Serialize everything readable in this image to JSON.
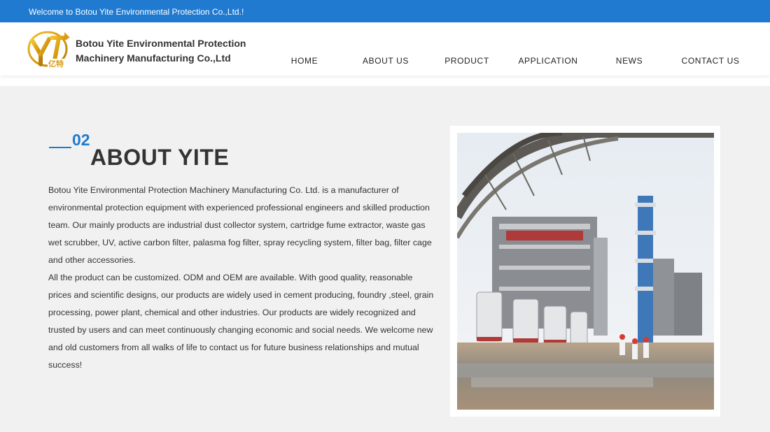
{
  "topbar": {
    "welcome": "Welcome to Botou Yite Environmental Protection Co.,Ltd.!"
  },
  "header": {
    "logo_icon": "yite-logo",
    "company_line1": "Botou Yite Environmental Protection",
    "company_line2": "Machinery Manufacturing Co.,Ltd"
  },
  "nav": {
    "items": [
      {
        "label": "HOME"
      },
      {
        "label": "ABOUT US"
      },
      {
        "label": "PRODUCT"
      },
      {
        "label": "APPLICATION"
      },
      {
        "label": "NEWS"
      },
      {
        "label": "CONTACT US"
      }
    ]
  },
  "about": {
    "number": "02",
    "title": "ABOUT YITE",
    "paragraph1": "Botou Yite Environmental Protection Machinery Manufacturing Co. Ltd. is a manufacturer of environmental protection equipment with experienced professional engineers and skilled production team. Our mainly products are industrial dust collector system, cartridge fume extractor, waste gas wet scrubber, UV, active carbon filter, palasma fog filter, spray recycling system,  filter bag, filter cage and other accessories.",
    "paragraph2": "All the product can be customized. ODM and OEM are available. With good quality, reasonable prices and scientific designs, our products are widely used in cement producing, foundry ,steel, grain processing, power plant, chemical and other industries. Our products are widely recognized and trusted by users and can meet continuously changing economic and social needs. We welcome new and old customers from all walks of life to contact us for future business relationships and mutual success!",
    "photo_icon": "industrial-plant-photo"
  },
  "colors": {
    "brand": "#1f7ad0",
    "background": "#f1f1f1",
    "text": "#333333"
  }
}
